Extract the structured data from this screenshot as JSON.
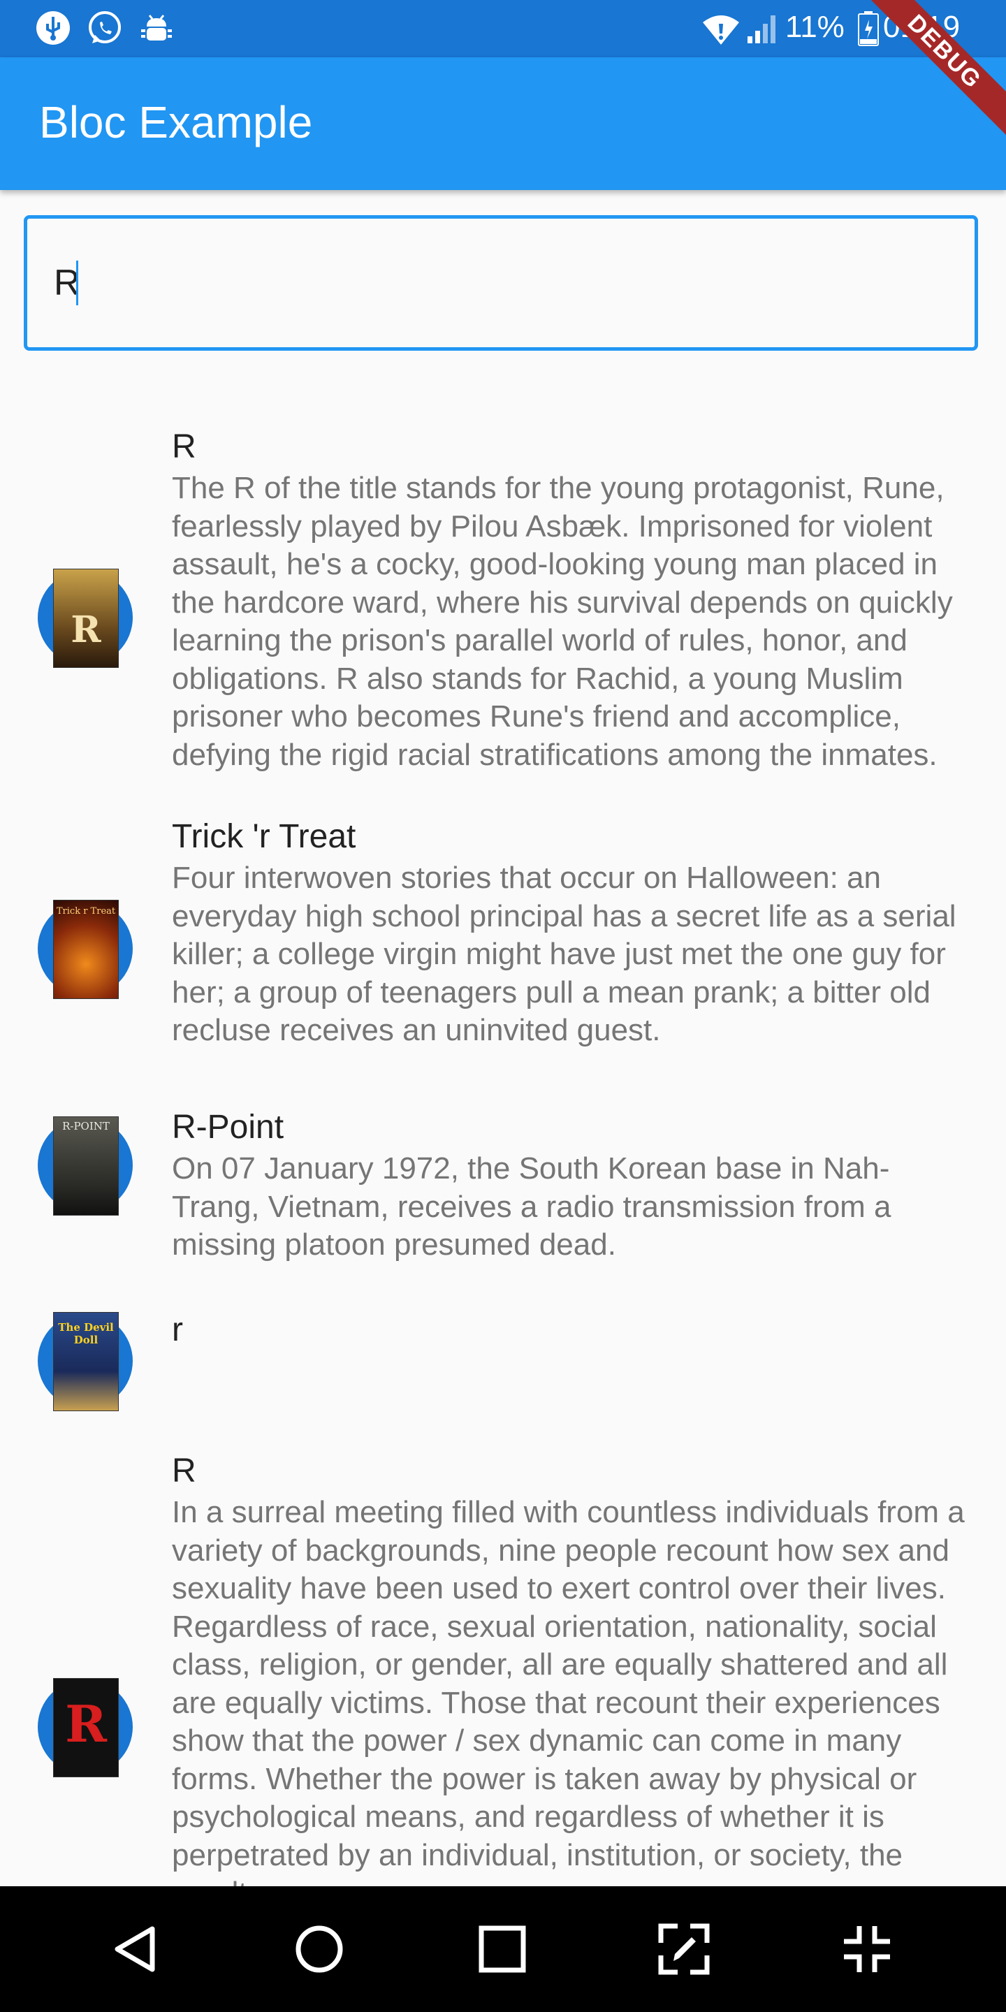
{
  "status_bar": {
    "battery": "11%",
    "time": "01:19",
    "left_icons": [
      "usb-icon",
      "whatsapp-icon",
      "android-debug-icon"
    ],
    "right_icons": [
      "wifi-icon",
      "signal-icon",
      "battery-icon"
    ]
  },
  "app_bar": {
    "title": "Bloc Example",
    "debug_banner": "DEBUG",
    "color": "#2196f3",
    "status_color": "#1976d2"
  },
  "search": {
    "value": "R",
    "border_color": "#2196f3"
  },
  "movies": [
    {
      "title": "R",
      "overview": "The R of the title stands for the young protagonist, Rune, fearlessly played by Pilou Asbæk. Imprisoned for violent assault, he's a cocky, good-looking young man placed in the hardcore ward, where his survival depends on quickly learning the prison's parallel world of rules, honor, and obligations. R also stands for Rachid, a young Muslim prisoner who becomes Rune's friend and accomplice, defying the rigid racial stratifications among the inmates.",
      "poster_letter": "R"
    },
    {
      "title": "Trick 'r Treat",
      "overview": "Four interwoven stories that occur on Halloween: an everyday high school principal has a secret life as a serial killer; a college virgin might have just met the one guy for her; a group of teenagers pull a mean prank; a bitter old recluse receives an uninvited guest.",
      "poster_letter": "Trick r Treat"
    },
    {
      "title": "R-Point",
      "overview": "On 07 January 1972, the South Korean base in Nah-Trang, Vietnam, receives a radio transmission from a missing platoon presumed dead.",
      "poster_letter": "R-POINT"
    },
    {
      "title": "r",
      "overview": "",
      "poster_letter": "The Devil Doll"
    },
    {
      "title": "R",
      "overview": "In a surreal meeting filled with countless individuals from a variety of backgrounds, nine people recount how sex and sexuality have been used to exert control over their lives. Regardless of race, sexual orientation, nationality, social class, religion, or gender, all are equally shattered and all are equally victims. Those that recount their experiences show that the power / sex dynamic can come in many forms. Whether the power is taken away by physical or psychological means, and regardless of whether it is perpetrated by an individual, institution, or society, the results are",
      "poster_letter": "R"
    }
  ],
  "nav_bar": {
    "buttons": [
      "back-icon",
      "home-icon",
      "recents-icon",
      "screenshot-edit-icon",
      "collapse-icon"
    ]
  }
}
